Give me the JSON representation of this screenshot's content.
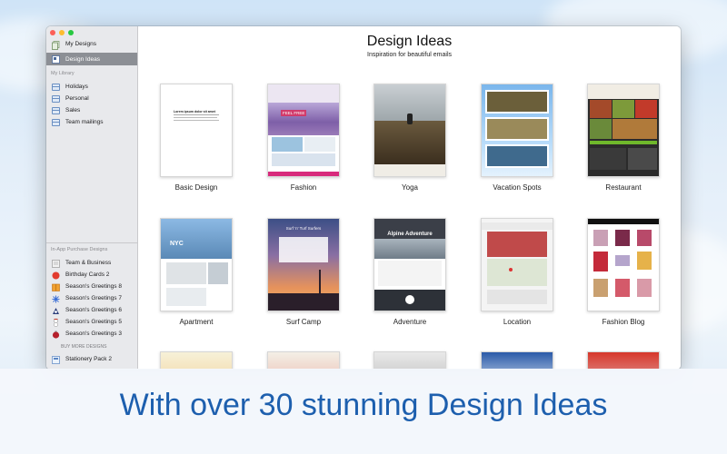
{
  "sidebar": {
    "top_items": [
      {
        "label": "My Designs",
        "icon": "designs-stack-icon"
      },
      {
        "label": "Design Ideas",
        "icon": "design-ideas-icon",
        "selected": true
      }
    ],
    "library_header": "My Library",
    "library_items": [
      {
        "label": "Holidays",
        "icon": "folder-icon"
      },
      {
        "label": "Personal",
        "icon": "folder-icon"
      },
      {
        "label": "Sales",
        "icon": "folder-icon"
      },
      {
        "label": "Team mailings",
        "icon": "folder-icon"
      }
    ],
    "purchase_header": "In-App Purchase Designs",
    "purchase_items": [
      {
        "label": "Team & Business",
        "icon": "business-icon"
      },
      {
        "label": "Birthday Cards 2",
        "icon": "balloon-icon"
      },
      {
        "label": "Season's Greetings 8",
        "icon": "gift-box-icon"
      },
      {
        "label": "Season's Greetings 7",
        "icon": "snowflake-icon"
      },
      {
        "label": "Season's Greetings 6",
        "icon": "santa-icon"
      },
      {
        "label": "Season's Greetings 5",
        "icon": "snowman-icon"
      },
      {
        "label": "Season's Greetings 3",
        "icon": "ornament-icon"
      }
    ],
    "buy_more_header": "BUY MORE DESIGNS",
    "buy_more_items": [
      {
        "label": "Stationery Pack 2",
        "icon": "stationery-icon"
      }
    ]
  },
  "main": {
    "title": "Design Ideas",
    "subtitle": "Inspiration for beautiful emails",
    "designs": [
      {
        "label": "Basic Design",
        "thumb_text": "Lorem ipsum dolor sit amet"
      },
      {
        "label": "Fashion",
        "thumb_text": "FEEL FREE"
      },
      {
        "label": "Yoga",
        "thumb_text": ""
      },
      {
        "label": "Vacation Spots",
        "thumb_text": ""
      },
      {
        "label": "Restaurant",
        "thumb_text": ""
      },
      {
        "label": "Apartment",
        "thumb_text": "NYC"
      },
      {
        "label": "Surf Camp",
        "thumb_text": "Surf 'n' Turf Surfers"
      },
      {
        "label": "Adventure",
        "thumb_text": "Alpine Adventure"
      },
      {
        "label": "Location",
        "thumb_text": ""
      },
      {
        "label": "Fashion Blog",
        "thumb_text": ""
      }
    ]
  },
  "banner": {
    "text": "With over 30 stunning Design Ideas"
  },
  "colors": {
    "banner_text": "#1d5fae",
    "sidebar_selected": "#8c8f95",
    "sidebar_bg": "#e8e9ec"
  }
}
